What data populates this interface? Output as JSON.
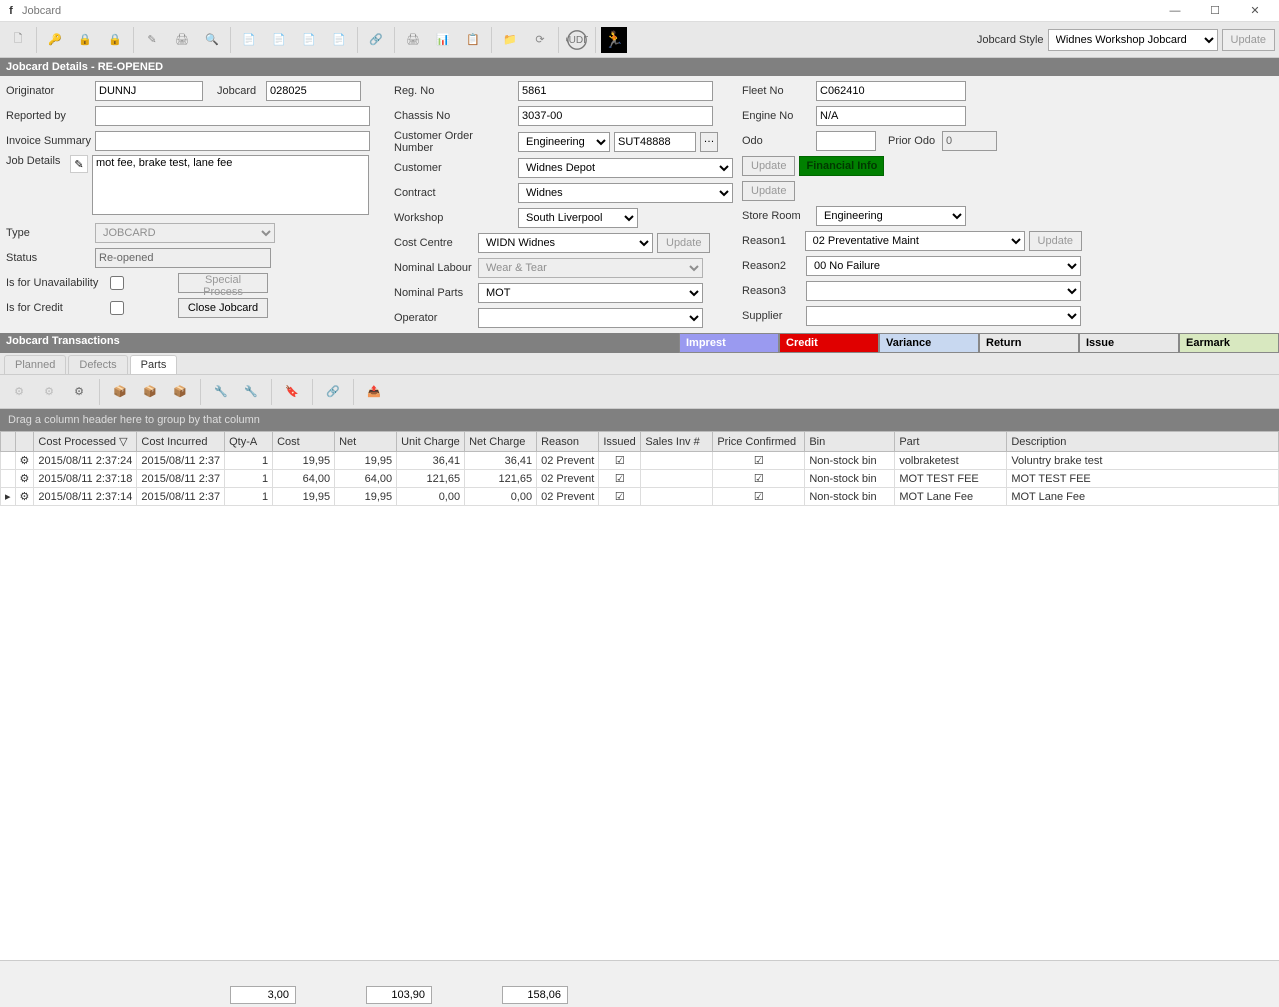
{
  "window": {
    "title": "Jobcard"
  },
  "toolbar": {
    "style_label": "Jobcard Style",
    "style_value": "Widnes Workshop Jobcard",
    "update": "Update"
  },
  "details": {
    "header": "Jobcard Details - RE-OPENED",
    "labels": {
      "originator": "Originator",
      "jobcard": "Jobcard",
      "reported": "Reported by",
      "invoice": "Invoice Summary",
      "jobdetails": "Job Details",
      "type": "Type",
      "status": "Status",
      "unavail": "Is for Unavailability",
      "credit": "Is for Credit",
      "special": "Special Process",
      "close": "Close Jobcard",
      "regno": "Reg. No",
      "chassis": "Chassis No",
      "custorder": "Customer Order Number",
      "customer": "Customer",
      "contract": "Contract",
      "workshop": "Workshop",
      "costcentre": "Cost Centre",
      "nomlabour": "Nominal Labour",
      "nomparts": "Nominal Parts",
      "operator": "Operator",
      "fleet": "Fleet No",
      "engine": "Engine No",
      "odo": "Odo",
      "priorodo": "Prior Odo",
      "storeroom": "Store Room",
      "reason1": "Reason1",
      "reason2": "Reason2",
      "reason3": "Reason3",
      "supplier": "Supplier",
      "update": "Update",
      "financial": "Financial Info"
    },
    "values": {
      "originator": "DUNNJ",
      "jobcard": "028025",
      "reported": "",
      "invoice": "",
      "jobdetails": "mot fee, brake test, lane fee",
      "type": "JOBCARD",
      "status": "Re-opened",
      "regno": "5861",
      "chassis": "3037-00",
      "custorder_cat": "Engineering",
      "custorder_no": "SUT48888",
      "customer": "Widnes Depot",
      "contract": "Widnes",
      "workshop": "South Liverpool",
      "costcentre": "WIDN Widnes",
      "nomlabour": "Wear & Tear",
      "nomparts": "MOT",
      "operator": "",
      "fleet": "C062410",
      "engine": "N/A",
      "odo": "",
      "priorodo": "0",
      "storeroom": "Engineering",
      "reason1": "02 Preventative Maint",
      "reason2": "00 No Failure",
      "reason3": "",
      "supplier": ""
    }
  },
  "trans": {
    "header": "Jobcard Transactions",
    "imprest": "Imprest",
    "credit": "Credit",
    "variance": "Variance",
    "return": "Return",
    "issue": "Issue",
    "earmark": "Earmark",
    "tabs": {
      "planned": "Planned",
      "defects": "Defects",
      "parts": "Parts"
    },
    "groupbar": "Drag a column header here to group by that column",
    "columns": {
      "costproc": "Cost Processed",
      "costinc": "Cost Incurred",
      "qty": "Qty-A",
      "cost": "Cost",
      "net": "Net",
      "unit": "Unit Charge",
      "netch": "Net Charge",
      "reason": "Reason",
      "issued": "Issued",
      "salesinv": "Sales Inv #",
      "priceconf": "Price Confirmed",
      "bin": "Bin",
      "part": "Part",
      "desc": "Description"
    },
    "rows": [
      {
        "costproc": "2015/08/11 2:37:24",
        "costinc": "2015/08/11 2:37",
        "qty": "1",
        "cost": "19,95",
        "net": "19,95",
        "unit": "36,41",
        "netch": "36,41",
        "reason": "02 Prevent",
        "issued": true,
        "salesinv": "",
        "priceconf": true,
        "bin": "Non-stock bin",
        "part": "volbraketest",
        "desc": "Voluntry brake test"
      },
      {
        "costproc": "2015/08/11 2:37:18",
        "costinc": "2015/08/11 2:37",
        "qty": "1",
        "cost": "64,00",
        "net": "64,00",
        "unit": "121,65",
        "netch": "121,65",
        "reason": "02 Prevent",
        "issued": true,
        "salesinv": "",
        "priceconf": true,
        "bin": "Non-stock bin",
        "part": "MOT TEST FEE",
        "desc": "MOT TEST FEE"
      },
      {
        "costproc": "2015/08/11 2:37:14",
        "costinc": "2015/08/11 2:37",
        "qty": "1",
        "cost": "19,95",
        "net": "19,95",
        "unit": "0,00",
        "netch": "0,00",
        "reason": "02 Prevent",
        "issued": true,
        "salesinv": "",
        "priceconf": true,
        "bin": "Non-stock bin",
        "part": "MOT Lane Fee",
        "desc": "MOT Lane Fee"
      }
    ],
    "totals": {
      "qty": "3,00",
      "cost": "103,90",
      "netch": "158,06"
    }
  }
}
